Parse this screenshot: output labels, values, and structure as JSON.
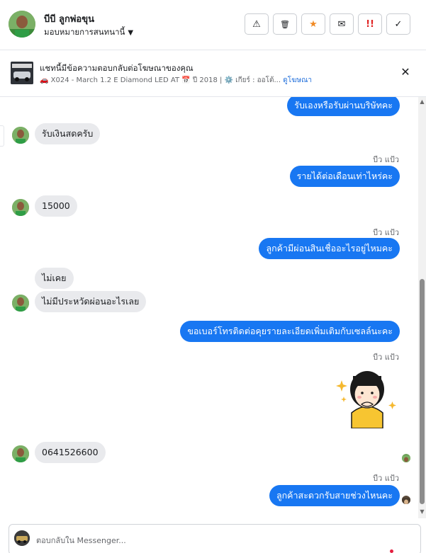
{
  "header": {
    "contact_name": "บีบี ลูกพ่อขุน",
    "assign_label": "มอบหมายการสนทนานี้",
    "actions": {
      "report_icon": "⚠",
      "delete_icon": "🗑",
      "star_icon": "★",
      "mail_icon": "✉",
      "spam_icon": "!!",
      "done_icon": "✓"
    }
  },
  "ad": {
    "title": "แชทนี้มีข้อความตอบกลับต่อโฆษณาของคุณ",
    "meta": "🚗 X024 - March 1.2 E Diamond LED AT 📅 ปี 2018 | ⚙️ เกียร์ : ออโต้...",
    "link": "ดูโฆษณา",
    "close_icon": "✕"
  },
  "messages": [
    {
      "text": "รับเองหรือรับผ่านบริษัทคะ"
    },
    {
      "text": "รับเงินสดครับ"
    },
    {
      "sender": "บีว แป้ว"
    },
    {
      "text": "รายได้ต่อเดือนเท่าไหร่คะ"
    },
    {
      "text": "15000"
    },
    {
      "sender": "บีว แป้ว"
    },
    {
      "text": "ลูกค้ามีผ่อนสินเชื่ออะไรอยู่ไหมคะ"
    },
    {
      "text": "ไม่เคย"
    },
    {
      "text": "ไม่มีประหวัดผ่อนอะไรเลย"
    },
    {
      "text": "ขอเบอร์โทรติดต่อคุยรายละเอียดเพิ่มเติมกับเซลล์นะคะ"
    },
    {
      "sender": "บีว แป้ว"
    },
    {
      "text": "0641526600"
    },
    {
      "sender": "บีว แป้ว"
    },
    {
      "text": "ลูกค้าสะดวกรับสายช่วงไหนคะ"
    }
  ],
  "composer": {
    "placeholder": "ตอบกลับใน Messenger..."
  },
  "colors": {
    "outgoing_bubble": "#1877f2",
    "incoming_bubble": "#e9eaed",
    "star": "#f08a24",
    "spam": "#e02424"
  }
}
